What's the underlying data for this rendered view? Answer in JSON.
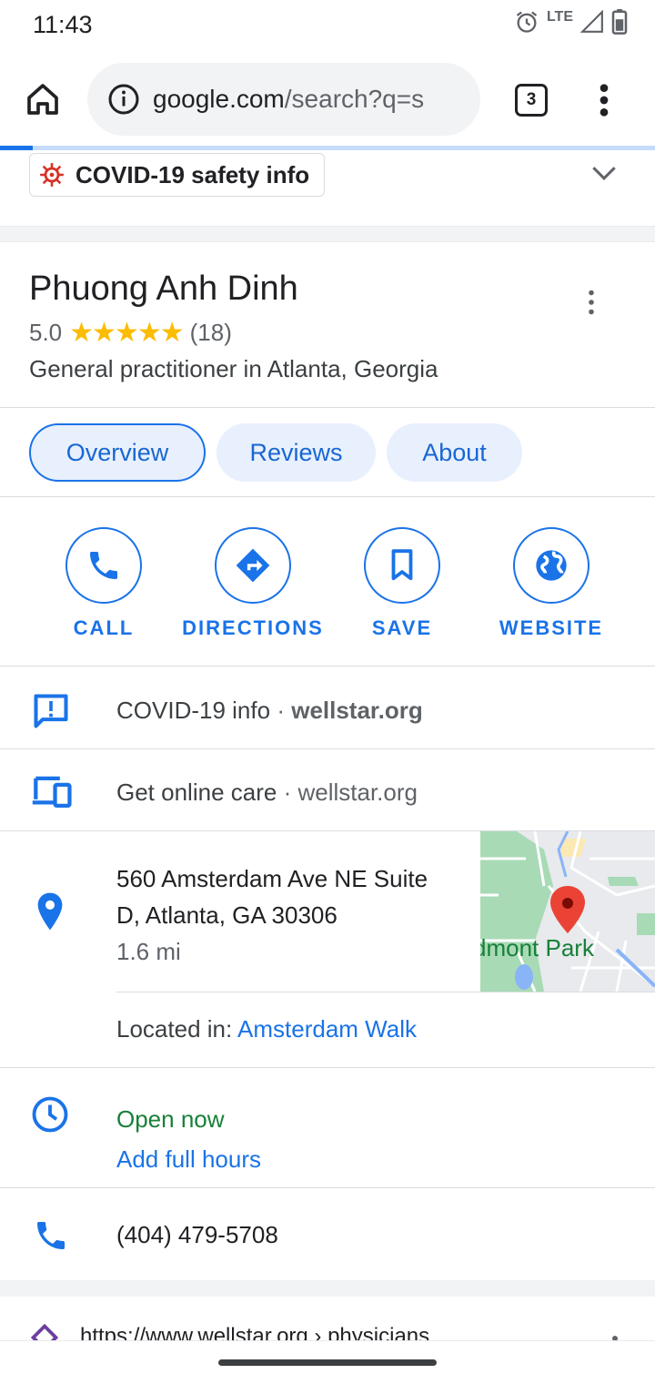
{
  "status": {
    "time": "11:43",
    "network": "LTE"
  },
  "browser": {
    "url_host": "google.com",
    "url_rest": "/search?q=s",
    "tab_count": "3",
    "load_progress": 0.05
  },
  "covid_chip": {
    "label": "COVID-19 safety info"
  },
  "place": {
    "name": "Phuong Anh Dinh",
    "rating": "5.0",
    "stars": "★★★★★",
    "review_count": "(18)",
    "category": "General practitioner in Atlanta, Georgia"
  },
  "tabs": [
    {
      "label": "Overview",
      "active": true
    },
    {
      "label": "Reviews",
      "active": false
    },
    {
      "label": "About",
      "active": false
    }
  ],
  "actions": [
    {
      "label": "CALL",
      "icon": "phone-icon"
    },
    {
      "label": "DIRECTIONS",
      "icon": "directions-icon"
    },
    {
      "label": "SAVE",
      "icon": "bookmark-icon"
    },
    {
      "label": "WEBSITE",
      "icon": "globe-icon"
    }
  ],
  "info": {
    "covid_label": "COVID-19 info",
    "covid_source": "wellstar.org",
    "online_label": "Get online care",
    "online_source": "wellstar.org",
    "address_line1": "560 Amsterdam Ave NE Suite",
    "address_line2": "D, Atlanta, GA 30306",
    "distance": "1.6 mi",
    "map_label": "dmont Park",
    "located_in_prefix": "Located in:",
    "located_in_link": "Amsterdam Walk",
    "hours_status": "Open now",
    "hours_link": "Add full hours",
    "phone": "(404) 479-5708"
  },
  "next_result": {
    "url": "https://www.wellstar.org › physicians"
  },
  "colors": {
    "accent": "#1a73e8",
    "pill_bg": "#e8f0fe",
    "open_green": "#188038",
    "star": "#fbbc04",
    "pin_red": "#ea4335"
  }
}
